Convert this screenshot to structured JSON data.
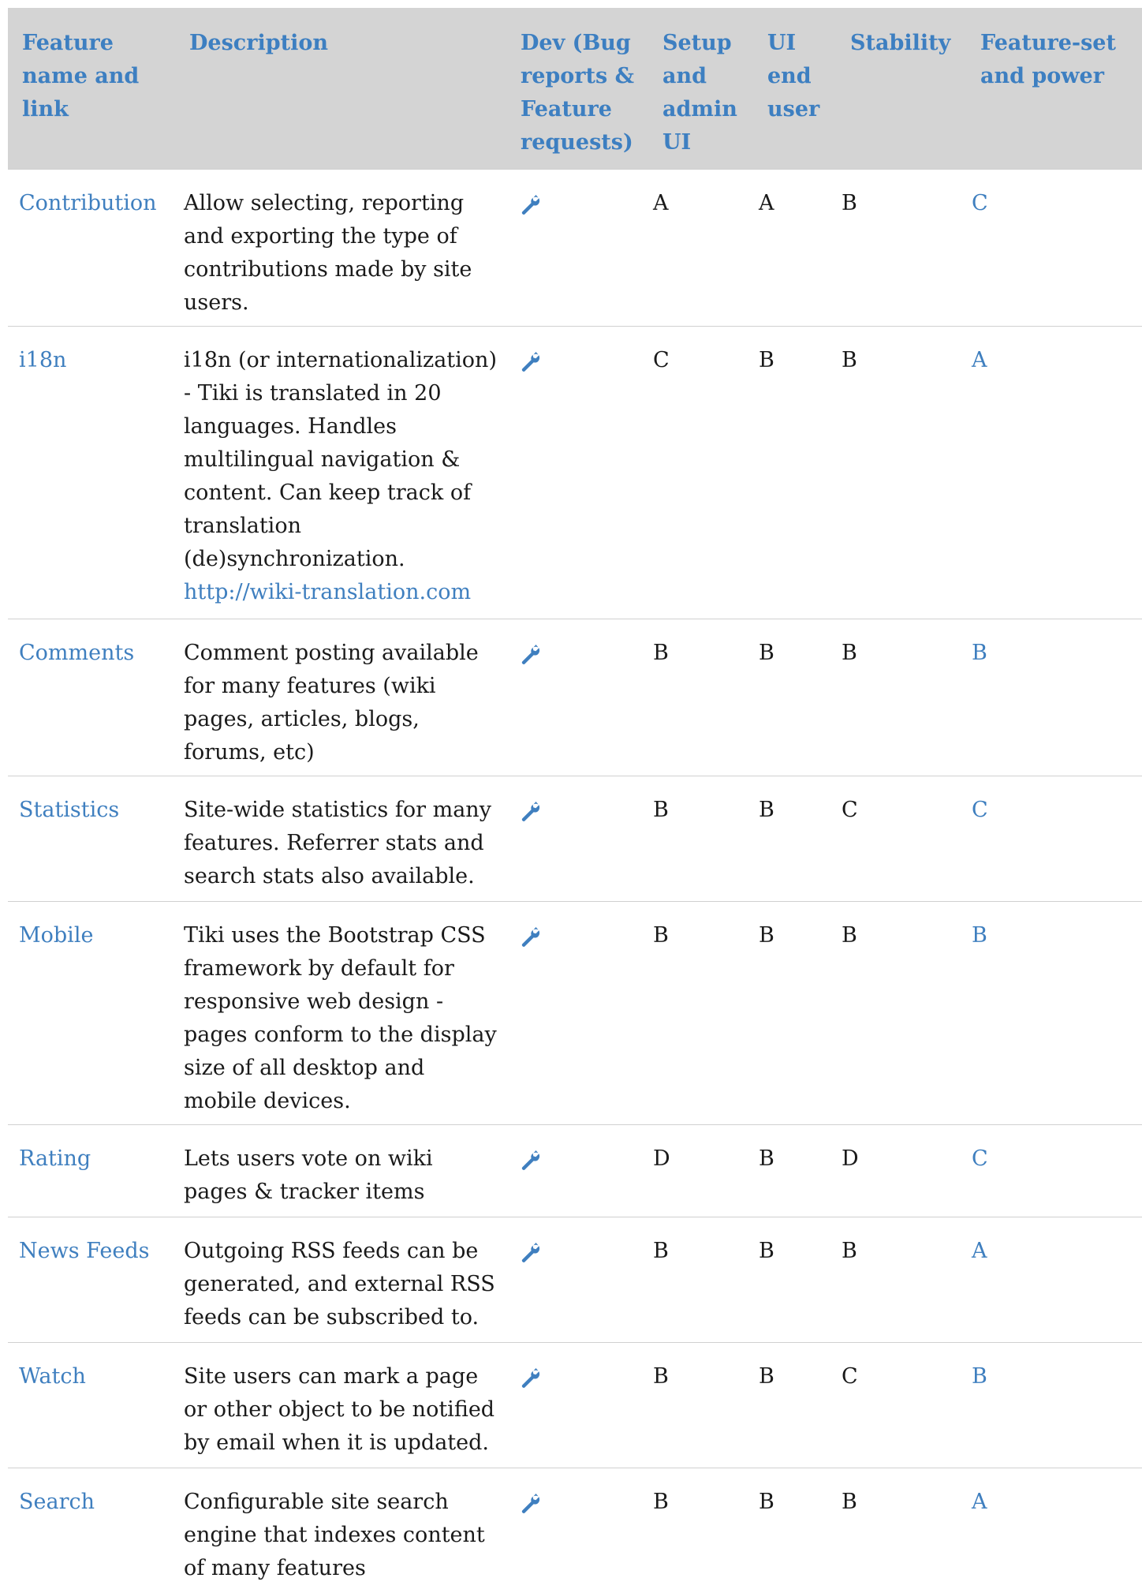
{
  "table": {
    "headers": [
      "Feature\nname and\nlink",
      "Description",
      "Dev (Bug\nreports &\nFeature\nrequests)",
      "Setup\nand\nadmin\nUI",
      "UI\nend\nuser",
      "Stability",
      "Feature-set\nand power"
    ],
    "dev_icon": "wrench-icon",
    "rows": [
      {
        "name": "Contribution",
        "description": "Allow selecting, reporting\nand exporting the type of\ncontributions made by site\nusers.",
        "link_line": "",
        "setup": "A",
        "ui": "A",
        "stability": "B",
        "power": "C"
      },
      {
        "name": "i18n",
        "description": "i18n (or internationalization)\n- Tiki is translated in 20\nlanguages. Handles\nmultilingual navigation &\ncontent. Can keep track of\ntranslation\n(de)synchronization.",
        "link_line": "http://wiki-translation.com",
        "setup": "C",
        "ui": "B",
        "stability": "B",
        "power": "A"
      },
      {
        "name": "Comments",
        "description": "Comment posting available\nfor many features (wiki\npages, articles, blogs,\nforums, etc)",
        "link_line": "",
        "setup": "B",
        "ui": "B",
        "stability": "B",
        "power": "B"
      },
      {
        "name": "Statistics",
        "description": "Site-wide statistics for many\nfeatures. Referrer stats and\nsearch stats also available.",
        "link_line": "",
        "setup": "B",
        "ui": "B",
        "stability": "C",
        "power": "C"
      },
      {
        "name": "Mobile",
        "description": "Tiki uses the Bootstrap CSS\nframework by default for\nresponsive web design -\npages conform to the display\nsize of all desktop and\nmobile devices.",
        "link_line": "",
        "setup": "B",
        "ui": "B",
        "stability": "B",
        "power": "B"
      },
      {
        "name": "Rating",
        "description": "Lets users vote on wiki\npages & tracker items",
        "link_line": "",
        "setup": "D",
        "ui": "B",
        "stability": "D",
        "power": "C"
      },
      {
        "name": "News Feeds",
        "description": "Outgoing RSS feeds can be\ngenerated, and external RSS\nfeeds can be subscribed to.",
        "link_line": "",
        "setup": "B",
        "ui": "B",
        "stability": "B",
        "power": "A"
      },
      {
        "name": "Watch",
        "description": "Site users can mark a page\nor other object to be notified\nby email when it is updated.",
        "link_line": "",
        "setup": "B",
        "ui": "B",
        "stability": "C",
        "power": "B"
      },
      {
        "name": "Search",
        "description": "Configurable site search\nengine that indexes content\nof many features",
        "link_line": "",
        "setup": "B",
        "ui": "B",
        "stability": "B",
        "power": "A"
      }
    ]
  },
  "colors": {
    "header_bg": "#d4d4d4",
    "header_text": "#3d7fc1",
    "link": "#3f7fbf",
    "text": "#1a1a1a"
  }
}
